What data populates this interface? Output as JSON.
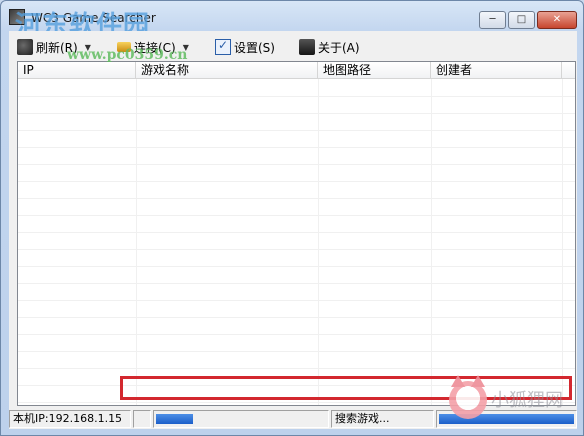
{
  "window": {
    "title": "WC3 Game Searcher",
    "minimize_label": "─",
    "maximize_label": "□",
    "close_label": "✕"
  },
  "watermark": {
    "site_name": "河东软件园",
    "site_url": "www.pc0359.cn",
    "corner_text": "小狐狸网"
  },
  "toolbar": {
    "refresh_label": "刷新(R)",
    "connect_label": "连接(C)",
    "settings_label": "设置(S)",
    "about_label": "关于(A)",
    "dropdown_arrow": "▼"
  },
  "table": {
    "columns": [
      "IP",
      "游戏名称",
      "地图路径",
      "创建者"
    ],
    "rows": []
  },
  "statusbar": {
    "local_ip": "本机IP:192.168.1.15",
    "status_text": "搜索游戏...",
    "progress_left": 0.22,
    "progress_right": 1.0
  },
  "colors": {
    "highlight_border": "#d3282f",
    "progress_blue": "#1c5fc9"
  }
}
